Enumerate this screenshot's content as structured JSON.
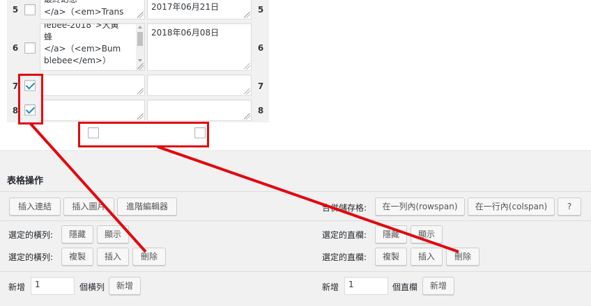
{
  "rows": [
    {
      "num": "5",
      "checked": false,
      "lines": [
        "最終幻想",
        "</a>（<em>Trans"
      ],
      "date": "2017年06月21日"
    },
    {
      "num": "6",
      "checked": false,
      "lines": [
        "lebee-2018\">大黃",
        "蜂",
        "</a>（<em>Bum",
        "blebee</em>）"
      ],
      "date": "2018年06月08日"
    },
    {
      "num": "7",
      "checked": true,
      "lines": [],
      "date": ""
    },
    {
      "num": "8",
      "checked": true,
      "lines": [],
      "date": ""
    }
  ],
  "ops": {
    "title": "表格操作",
    "toolbar": {
      "insert_link": "插入連結",
      "insert_image": "插入圖片",
      "advanced_editor": "進階編輯器",
      "merge_label": "合併儲存格:",
      "rowspan": "在一列內(rowspan)",
      "colspan": "在一行內(colspan)",
      "help": "?"
    },
    "rows_section": {
      "selected_label": "選定的橫列:",
      "hide": "隱藏",
      "show": "顯示",
      "duplicate": "複製",
      "insert": "插入",
      "delete": "刪除",
      "add_label": "新增",
      "add_value": "1",
      "unit": "個橫列",
      "add_button": "新增"
    },
    "cols_section": {
      "selected_label": "選定的直欄:",
      "hide": "隱藏",
      "show": "顯示",
      "duplicate": "複製",
      "insert": "插入",
      "delete": "刪除",
      "add_label": "新增",
      "add_value": "1",
      "unit": "個直欄",
      "add_button": "新增"
    }
  },
  "annotation_color": "#e2090f",
  "accent_color": "#1e8cbe"
}
